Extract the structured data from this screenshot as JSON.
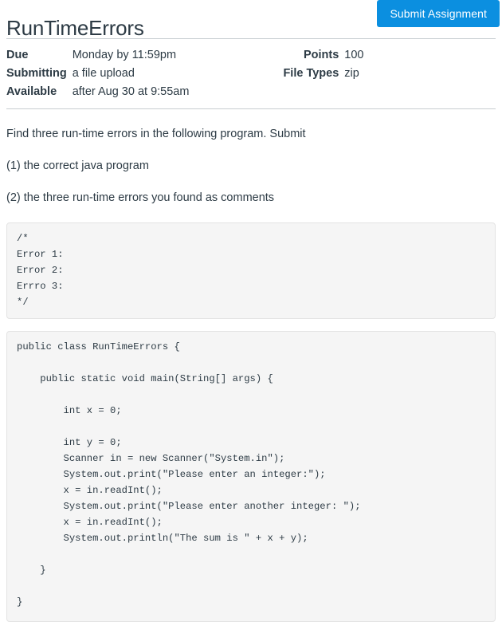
{
  "header": {
    "title": "RunTimeErrors",
    "submit_label": "Submit Assignment",
    "accent_color": "#0b8fe0"
  },
  "details": {
    "rows": [
      {
        "label": "Due",
        "value": "Monday by 11:59pm",
        "label2": "Points",
        "value2": "100"
      },
      {
        "label": "Submitting",
        "value": "a file upload",
        "label2": "File Types",
        "value2": "zip"
      },
      {
        "label": "Available",
        "value": "after Aug 30 at 9:55am",
        "label2": "",
        "value2": ""
      }
    ]
  },
  "description": {
    "paragraphs": [
      "Find three run-time errors in the following program. Submit",
      "(1) the correct java program",
      "(2) the three run-time errors you found as comments"
    ]
  },
  "code_blocks": [
    {
      "name": "errors-comment-template",
      "text": "/*\nError 1:\nError 2:\nErrro 3:\n*/"
    },
    {
      "name": "java-program-listing",
      "text": "public class RunTimeErrors {\n\n    public static void main(String[] args) {\n\n        int x = 0;\n\n        int y = 0;\n        Scanner in = new Scanner(\"System.in\");\n        System.out.print(\"Please enter an integer:\");\n        x = in.readInt();\n        System.out.print(\"Please enter another integer: \");\n        x = in.readInt();\n        System.out.println(\"The sum is \" + x + y);\n\n    }\n\n}"
    }
  ]
}
